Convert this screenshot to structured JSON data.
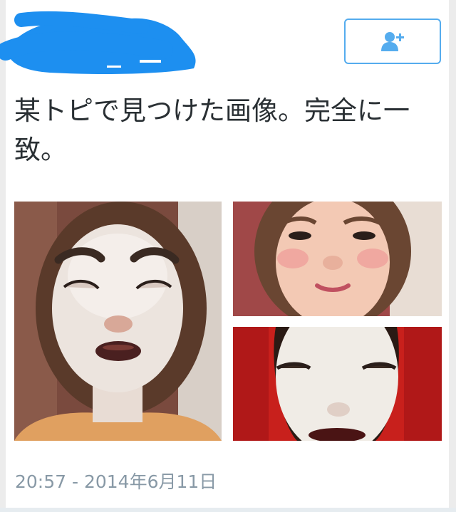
{
  "header": {
    "username": "",
    "follow_icon": "add-user-icon"
  },
  "tweet": {
    "text": "某トピで見つけた画像。完全に一致。",
    "timestamp": "20:57 - 2014年6月11日"
  },
  "media": {
    "images": [
      "photo-edited",
      "photo-original",
      "photo-noh-mask"
    ]
  },
  "colors": {
    "accent": "#55acee",
    "text": "#292f33",
    "muted": "#8899a6",
    "scribble": "#1d8ff0"
  }
}
